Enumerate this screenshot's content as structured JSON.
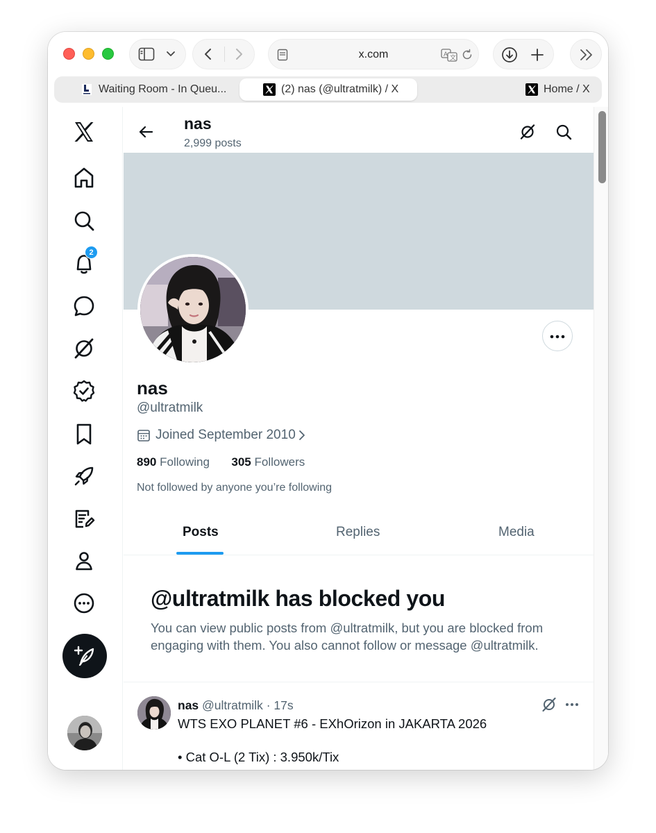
{
  "browser": {
    "address": "x.com",
    "tabs": [
      {
        "label": "Waiting Room - In Queu...",
        "active": false,
        "favicon": "loket-favicon"
      },
      {
        "label": "(2) nas (@ultratmilk) / X",
        "active": true,
        "favicon": "x-favicon"
      },
      {
        "label": "Home / X",
        "active": false,
        "favicon": "x-favicon"
      }
    ]
  },
  "nav": {
    "notifications_badge": "2",
    "items": [
      "x-logo",
      "home-icon",
      "search-icon",
      "notifications-icon",
      "messages-icon",
      "grok-icon",
      "verified-icon",
      "bookmarks-icon",
      "rocket-icon",
      "edit-note-icon",
      "profile-icon",
      "more-icon"
    ]
  },
  "header": {
    "name": "nas",
    "posts": "2,999 posts"
  },
  "profile": {
    "name": "nas",
    "handle": "@ultratmilk",
    "joined": "Joined September 2010",
    "following_count": "890",
    "following_label": "Following",
    "followers_count": "305",
    "followers_label": "Followers",
    "not_followed": "Not followed by anyone you’re following"
  },
  "tabs": [
    "Posts",
    "Replies",
    "Media"
  ],
  "blocked": {
    "title": "@ultratmilk has blocked you",
    "body": "You can view public posts from @ultratmilk, but you are blocked from engaging with them. You also cannot follow or message @ultratmilk."
  },
  "tweet": {
    "name": "nas",
    "handle": "@ultratmilk",
    "sep": "·",
    "time": "17s",
    "line1": "WTS EXO PLANET #6 - EXhOrizon in JAKARTA 2026",
    "line2": "• Cat O-L (2 Tix) : 3.950k/Tix"
  },
  "colors": {
    "accent": "#1d9bf0",
    "banner": "#cfd9de",
    "text_primary": "#0f1419",
    "text_secondary": "#536471"
  }
}
